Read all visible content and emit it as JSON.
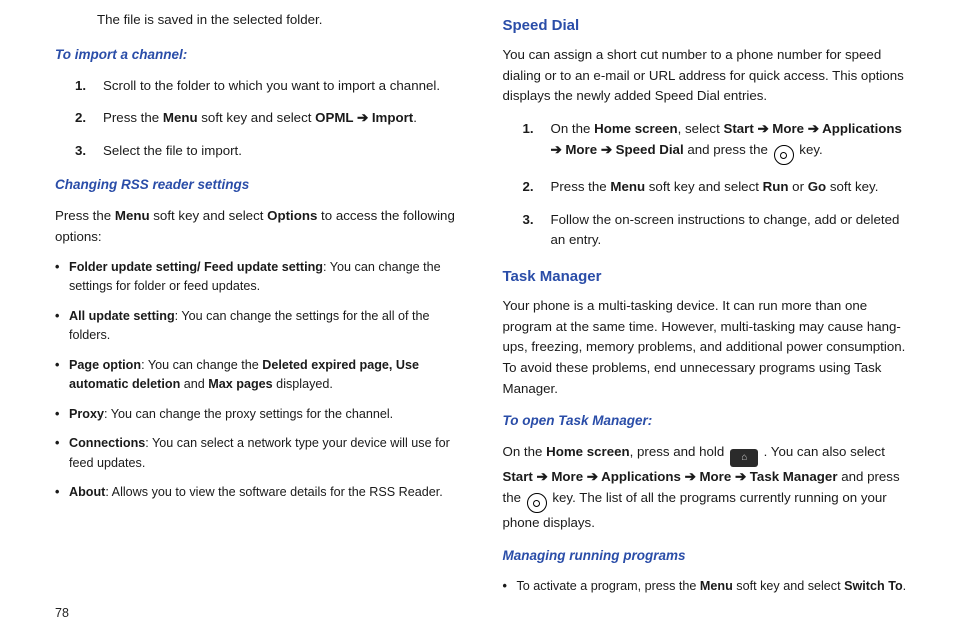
{
  "page_number": "78",
  "left": {
    "leadline": "The file is saved in the selected folder.",
    "import_heading": "To import a channel:",
    "import_steps": {
      "s1": "Scroll to the folder to which you want to import a channel.",
      "s2_a": "Press the ",
      "s2_menu": "Menu",
      "s2_b": " soft key and select ",
      "s2_opml": "OPML",
      "s2_arrow": " ➔ ",
      "s2_import": "Import",
      "s2_end": ".",
      "s3": "Select the file to import."
    },
    "rss_heading": "Changing RSS reader settings",
    "rss_intro_a": "Press the ",
    "rss_intro_menu": "Menu",
    "rss_intro_b": " soft key and select ",
    "rss_intro_options": "Options",
    "rss_intro_c": " to access the following options:",
    "bullets": {
      "b1_bold": "Folder update setting/ Feed update setting",
      "b1_rest": ": You can change the settings for folder or feed updates.",
      "b2_bold": "All update setting",
      "b2_rest": ": You can change the settings for the all of the folders.",
      "b3_bold": "Page option",
      "b3_mid": ": You can change the ",
      "b3_bold2": "Deleted expired page, Use automatic deletion",
      "b3_and": " and ",
      "b3_bold3": "Max pages",
      "b3_end": " displayed.",
      "b4_bold": "Proxy",
      "b4_rest": ": You can change the proxy settings for the channel.",
      "b5_bold": "Connections",
      "b5_rest": ": You can select a network type your device will use for feed updates.",
      "b6_bold": "About",
      "b6_rest": ": Allows you to view the software details for the RSS Reader."
    }
  },
  "right": {
    "sd_heading": "Speed Dial",
    "sd_intro": "You can assign a short cut number to a phone number for speed dialing or to an e-mail or URL address for quick access. This options displays the newly added Speed Dial entries.",
    "sd_steps": {
      "s1_a": "On the ",
      "s1_home": "Home screen",
      "s1_b": ", select ",
      "s1_start": "Start",
      "arrow": " ➔ ",
      "s1_more": "More",
      "s1_apps": "Applications",
      "s1_sdial": "Speed Dial",
      "s1_press": " and press the ",
      "s1_key": " key.",
      "s2_a": "Press the ",
      "s2_menu": "Menu",
      "s2_b": " soft key and select ",
      "s2_run": "Run",
      "s2_or": " or ",
      "s2_go": "Go",
      "s2_end": " soft key.",
      "s3": "Follow the on-screen instructions to change, add or deleted an entry."
    },
    "tm_heading": "Task Manager",
    "tm_intro": "Your phone is a multi-tasking device. It can run more than one program at the same time. However, multi-tasking may cause hang-ups, freezing, memory problems, and additional power consumption. To avoid these problems, end unnecessary programs using Task Manager.",
    "tm_open_heading": "To open Task Manager:",
    "tm_open": {
      "a": "On the ",
      "home": "Home screen",
      "b": ", press and hold ",
      "c": " . You can also select ",
      "start": "Start",
      "arrow": " ➔ ",
      "more": "More",
      "apps": "Applications",
      "tmgr": "Task Manager",
      "press": " and press the ",
      "key_end": " key. The list of all the programs currently running on your phone displays."
    },
    "mg_heading": "Managing running programs",
    "mg_bullet": {
      "a": "To activate a program, press the ",
      "menu": "Menu",
      "b": " soft key and select ",
      "switch": "Switch To",
      "end": "."
    }
  }
}
